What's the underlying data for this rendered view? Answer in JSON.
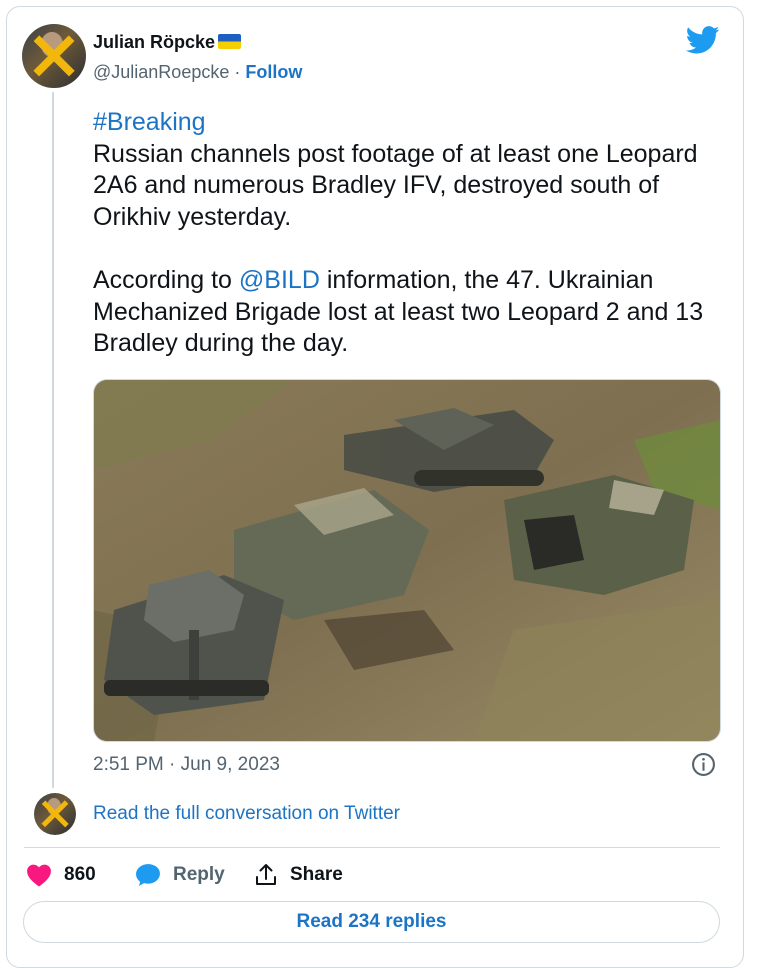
{
  "author": {
    "name": "Julian Röpcke",
    "handle": "@JulianRoepcke",
    "separator": "·",
    "follow_label": "Follow"
  },
  "tweet": {
    "hashtag": "#Breaking",
    "line1": "Russian channels post footage of at least one Leopard 2A6 and numerous Bradley IFV, destroyed south of Orikhiv yesterday.",
    "line2_prefix": "According to",
    "mention": "@BILD",
    "line2_suffix": "information, the 47. Ukrainian Mechanized Brigade lost at least two Leopard 2 and 13 Bradley during the day.",
    "timestamp": "2:51 PM · Jun 9, 2023"
  },
  "conversation": {
    "link_label": "Read the full conversation on Twitter"
  },
  "actions": {
    "like_count": "860",
    "reply_label": "Reply",
    "share_label": "Share",
    "read_replies_label": "Read 234 replies"
  },
  "icons": {
    "brand": "twitter-bird-icon",
    "info": "info-icon",
    "like": "heart-icon",
    "reply": "speech-bubble-icon",
    "share": "share-upload-icon"
  },
  "colors": {
    "link": "#1d74c4",
    "twitter_blue": "#1d9bf0",
    "like_red": "#f91880",
    "muted": "#536471",
    "border": "#cfd9de"
  }
}
